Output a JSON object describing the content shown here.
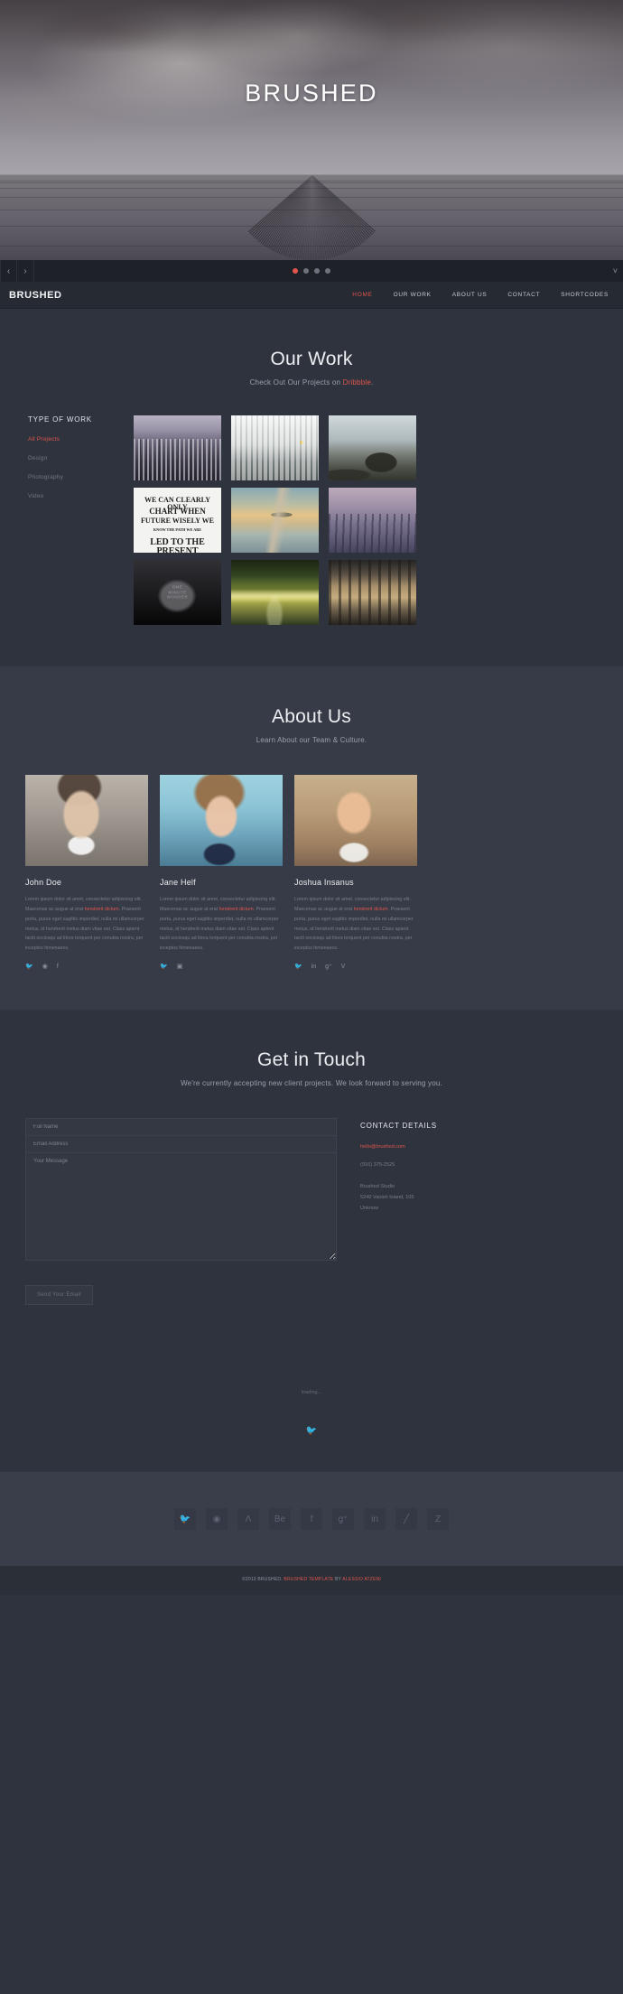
{
  "hero": {
    "title": "BRUSHED"
  },
  "slider": {
    "prev_label": "‹",
    "next_label": "›",
    "toggle_label": "˅",
    "dots": [
      {
        "active": true
      },
      {
        "active": false
      },
      {
        "active": false
      },
      {
        "active": false
      }
    ]
  },
  "navbar": {
    "brand": "BRUSHED",
    "items": [
      {
        "label": "HOME",
        "active": true
      },
      {
        "label": "OUR WORK",
        "active": false
      },
      {
        "label": "ABOUT US",
        "active": false
      },
      {
        "label": "CONTACT",
        "active": false
      },
      {
        "label": "SHORTCODES",
        "active": false
      }
    ]
  },
  "work": {
    "title": "Our Work",
    "subtitle_prefix": "Check Out Our Projects on ",
    "subtitle_link": "Dribbble",
    "subtitle_suffix": ".",
    "filter_title": "TYPE OF WORK",
    "filters": [
      {
        "label": "All Projects",
        "active": true
      },
      {
        "label": "Design",
        "active": false
      },
      {
        "label": "Photography",
        "active": false
      },
      {
        "label": "Video",
        "active": false
      }
    ],
    "items": [
      {
        "name": "cityscape-aerial",
        "art": "art-city"
      },
      {
        "name": "office-interior",
        "art": "art-office"
      },
      {
        "name": "mountain-peak-climber",
        "art": "art-peak"
      },
      {
        "name": "typography-poster",
        "art": "art-typo"
      },
      {
        "name": "lake-pier-sunset",
        "art": "art-lake"
      },
      {
        "name": "wooden-boardwalk",
        "art": "art-boards"
      },
      {
        "name": "one-minute-wonder",
        "art": "art-onemin"
      },
      {
        "name": "road-at-dusk",
        "art": "art-road"
      },
      {
        "name": "corridor-perspective",
        "art": "art-corridor"
      }
    ],
    "poster_lines": [
      "WE CAN CLEARLY ONLY",
      "CHART WHEN",
      "FUTURE WISELY WE",
      "KNOW THE PATH WE ARE",
      "LED TO THE PRESENT"
    ],
    "onemin_label": "ONE\nMINUTE\nWONDER"
  },
  "about": {
    "title": "About Us",
    "subtitle": "Learn About our Team & Culture.",
    "bio_part1": "Lorem ipsum dolor sit amet, consectetur adipiscing elit. Maecenas ac augue at erat ",
    "bio_accent": "hendrerit dictum",
    "bio_part2": ". Praesent porta, purus eget sagittis imperdiet, nulla mi ullamcorper metus, id hendrerit metus diam vitae est. Class aptent taciti sociosqu ad litora torquent per conubia nostra, per inceptos himenaeos.",
    "members": [
      {
        "name": "John Doe",
        "photo": "ph-john",
        "socials": [
          {
            "name": "twitter-icon",
            "glyph": "🐦"
          },
          {
            "name": "dribbble-icon",
            "glyph": "◉"
          },
          {
            "name": "facebook-icon",
            "glyph": "f"
          }
        ]
      },
      {
        "name": "Jane Helf",
        "photo": "ph-jane",
        "socials": [
          {
            "name": "twitter-icon",
            "glyph": "🐦"
          },
          {
            "name": "instagram-icon",
            "glyph": "▣"
          }
        ]
      },
      {
        "name": "Joshua Insanus",
        "photo": "ph-josh",
        "socials": [
          {
            "name": "twitter-icon",
            "glyph": "🐦"
          },
          {
            "name": "linkedin-icon",
            "glyph": "in"
          },
          {
            "name": "googleplus-icon",
            "glyph": "g⁺"
          },
          {
            "name": "vimeo-icon",
            "glyph": "V"
          }
        ]
      }
    ]
  },
  "contact": {
    "title": "Get in Touch",
    "subtitle": "We're currently accepting new client projects. We look forward to serving you.",
    "form": {
      "name_placeholder": "Full Name",
      "email_placeholder": "Email Address",
      "message_placeholder": "Your Message",
      "submit_label": "Send Your Email"
    },
    "details": {
      "title": "CONTACT DETAILS",
      "email": "hello@brushed.com",
      "phone": "(916) 375-2525",
      "address_line1": "Brushed Studio",
      "address_line2": "5240 Vanish Island, 105",
      "address_line3": "Unknow"
    }
  },
  "twitter": {
    "loading": "loading...",
    "bird_icon": "🐦"
  },
  "social_footer": {
    "items": [
      {
        "name": "twitter-icon",
        "glyph": "🐦"
      },
      {
        "name": "dribbble-icon",
        "glyph": "◉"
      },
      {
        "name": "forrst-icon",
        "glyph": "Λ"
      },
      {
        "name": "behance-icon",
        "glyph": "Be"
      },
      {
        "name": "facebook-icon",
        "glyph": "f"
      },
      {
        "name": "googleplus-icon",
        "glyph": "g⁺"
      },
      {
        "name": "linkedin-icon",
        "glyph": "in"
      },
      {
        "name": "pencil-icon",
        "glyph": "╱"
      },
      {
        "name": "zerply-icon",
        "glyph": "Z"
      }
    ]
  },
  "copyright": {
    "prefix": "©2013 BRUSHED. ",
    "link1": "BRUSHED TEMPLATE",
    "middle": " BY ",
    "link2": "ALESSIO ATZENI"
  },
  "colors": {
    "accent": "#e0554d",
    "bg_dark": "#2f333e",
    "bg_light": "#373b47",
    "nav_bg": "#262a33",
    "slidebar_bg": "#1e2128"
  }
}
